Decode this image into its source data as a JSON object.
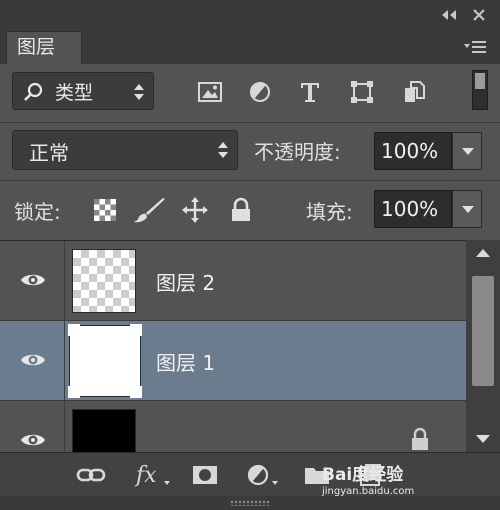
{
  "panel": {
    "tab_label": "图层"
  },
  "filter": {
    "kind_label": "类型",
    "icons": [
      "image-filter-icon",
      "adjustment-filter-icon",
      "type-filter-icon",
      "shape-filter-icon",
      "smart-object-filter-icon"
    ]
  },
  "blend": {
    "mode": "正常",
    "opacity_label": "不透明度:",
    "opacity_value": "100%"
  },
  "lock": {
    "label": "锁定:",
    "fill_label": "填充:",
    "fill_value": "100%"
  },
  "layers": [
    {
      "name": "图层 2",
      "visible": true,
      "selected": false,
      "thumbnail": "transparent"
    },
    {
      "name": "图层 1",
      "visible": true,
      "selected": true,
      "thumbnail": "white"
    },
    {
      "name": "",
      "visible": true,
      "selected": false,
      "thumbnail": "black",
      "locked": true
    }
  ],
  "watermark": {
    "brand": "Bai度经验",
    "url": "jingyan.baidu.com"
  },
  "colors": {
    "panel_bg": "#535353",
    "selected_row": "#6b7c8e",
    "dark_field": "#2d2d2d"
  }
}
